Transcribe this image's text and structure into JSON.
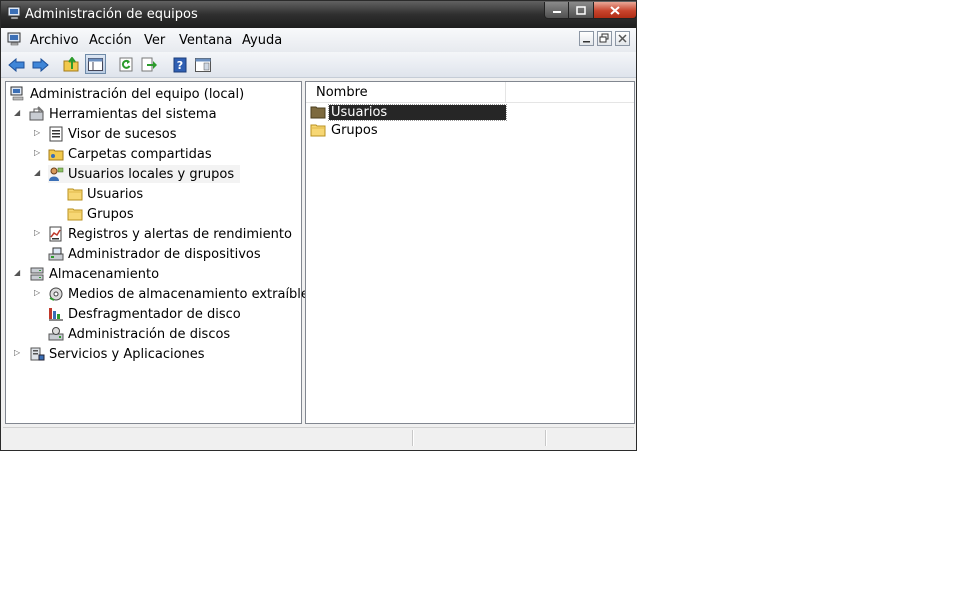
{
  "window": {
    "title": "Administración de equipos",
    "controls": {
      "minimize": "minimize",
      "maximize": "maximize",
      "close": "close"
    }
  },
  "menu": {
    "items": [
      {
        "label": "Archivo"
      },
      {
        "label": "Acción"
      },
      {
        "label": "Ver"
      },
      {
        "label": "Ventana"
      },
      {
        "label": "Ayuda"
      }
    ]
  },
  "toolbar": {
    "buttons": [
      "back-icon",
      "forward-icon",
      "up-folder-icon",
      "show-hide-tree-icon",
      "refresh-icon",
      "export-list-icon",
      "help-icon",
      "properties-pane-icon"
    ]
  },
  "tree": {
    "items": [
      {
        "label": "Administración del equipo (local)",
        "icon": "computer-management-icon",
        "level": 0,
        "expander": "none"
      },
      {
        "label": "Herramientas del sistema",
        "icon": "system-tools-icon",
        "level": 1,
        "expander": "expanded"
      },
      {
        "label": "Visor de sucesos",
        "icon": "event-viewer-icon",
        "level": 2,
        "expander": "collapsed"
      },
      {
        "label": "Carpetas compartidas",
        "icon": "shared-folders-icon",
        "level": 2,
        "expander": "collapsed"
      },
      {
        "label": "Usuarios locales y grupos",
        "icon": "local-users-groups-icon",
        "level": 2,
        "expander": "expanded"
      },
      {
        "label": "Usuarios",
        "icon": "folder-icon",
        "level": 3,
        "expander": "none"
      },
      {
        "label": "Grupos",
        "icon": "folder-icon",
        "level": 3,
        "expander": "none"
      },
      {
        "label": "Registros y alertas de rendimiento",
        "icon": "performance-logs-icon",
        "level": 2,
        "expander": "collapsed"
      },
      {
        "label": "Administrador de dispositivos",
        "icon": "device-manager-icon",
        "level": 2,
        "expander": "none"
      },
      {
        "label": "Almacenamiento",
        "icon": "storage-icon",
        "level": 1,
        "expander": "expanded"
      },
      {
        "label": "Medios de almacenamiento extraíbles",
        "icon": "removable-storage-icon",
        "level": 2,
        "expander": "collapsed"
      },
      {
        "label": "Desfragmentador de disco",
        "icon": "defragmenter-icon",
        "level": 2,
        "expander": "none"
      },
      {
        "label": "Administración de discos",
        "icon": "disk-management-icon",
        "level": 2,
        "expander": "none"
      },
      {
        "label": "Servicios y Aplicaciones",
        "icon": "services-applications-icon",
        "level": 1,
        "expander": "collapsed"
      }
    ]
  },
  "list": {
    "column_header": "Nombre",
    "rows": [
      {
        "label": "Usuarios",
        "icon": "folder-icon",
        "selected": true
      },
      {
        "label": "Grupos",
        "icon": "folder-icon",
        "selected": false
      }
    ]
  },
  "colors": {
    "titlebar": "#2f2f2f",
    "selection": "#262626",
    "folder": "#f2c94c"
  }
}
